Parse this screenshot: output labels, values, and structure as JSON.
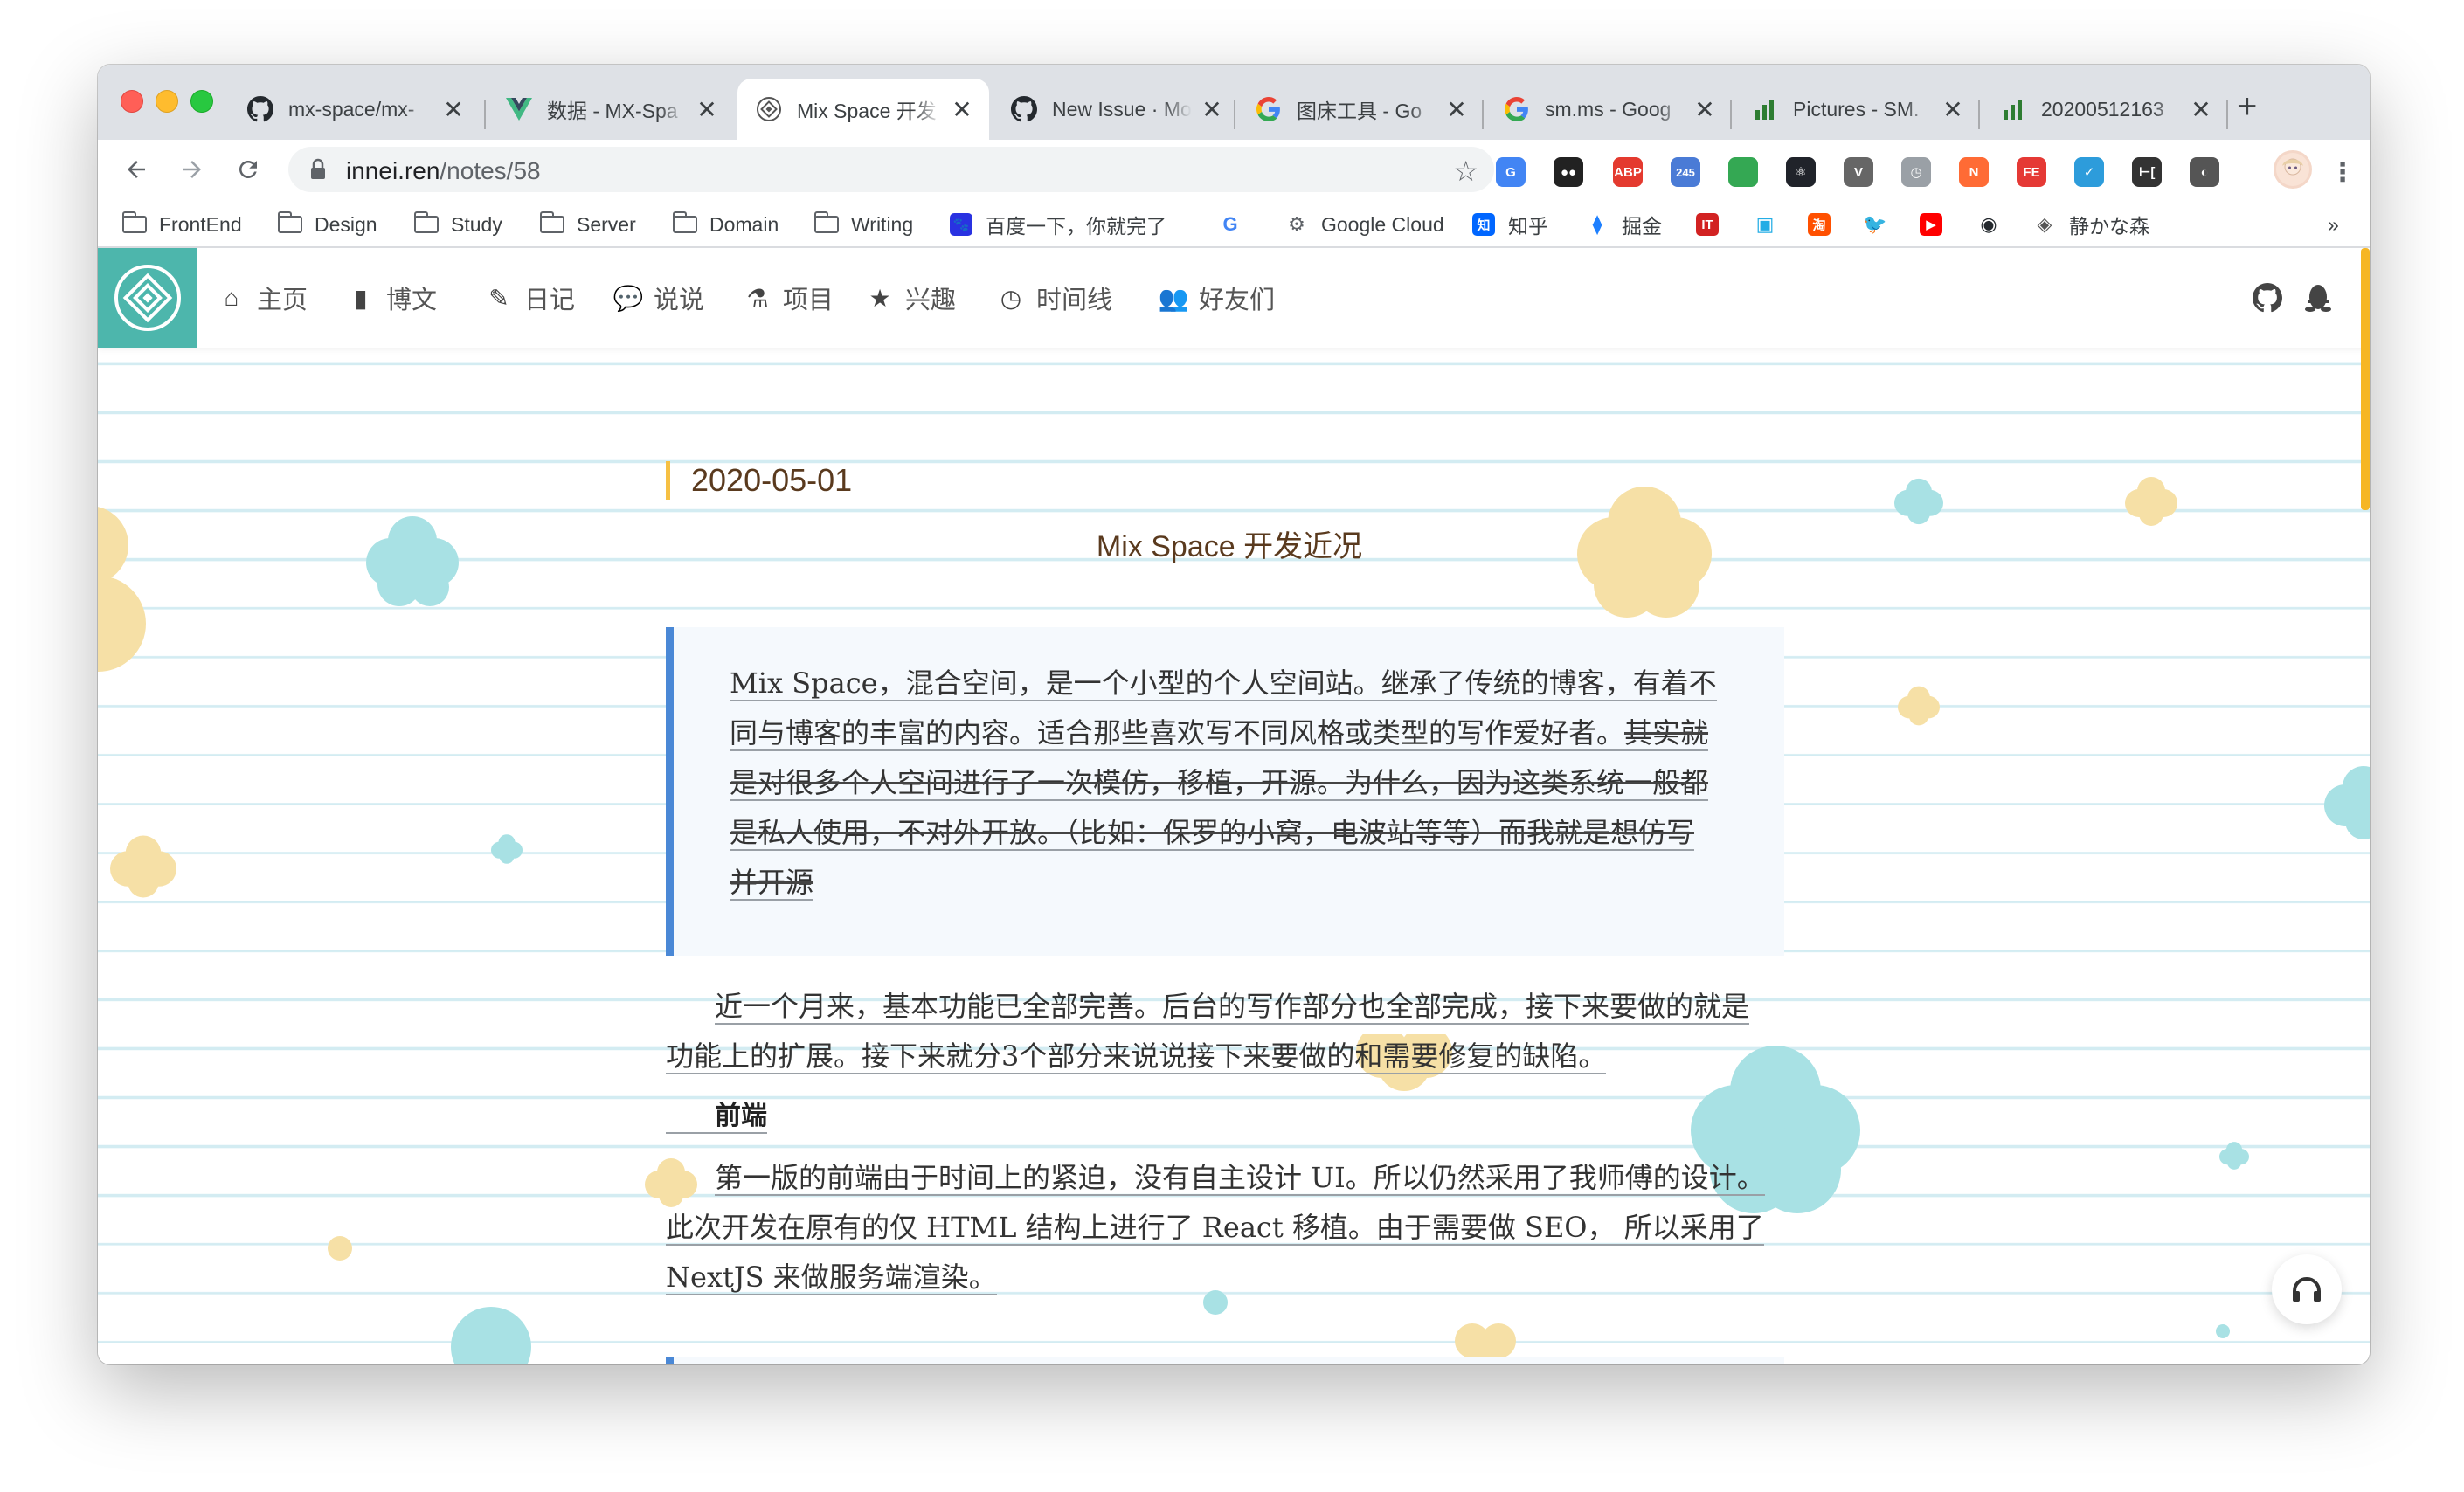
{
  "browser": {
    "tabs": [
      {
        "title": "mx-space/mx-",
        "icon": "github-icon"
      },
      {
        "title": "数据 - MX-Spa",
        "icon": "vue-icon"
      },
      {
        "title": "Mix Space 开发",
        "icon": "mix-space-icon",
        "active": true
      },
      {
        "title": "New Issue · Mo",
        "icon": "github-icon"
      },
      {
        "title": "图床工具 - Go",
        "icon": "google-icon"
      },
      {
        "title": "sm.ms - Goog",
        "icon": "google-icon"
      },
      {
        "title": "Pictures - SM.",
        "icon": "bar-chart-icon"
      },
      {
        "title": "20200512163",
        "icon": "bar-chart-icon"
      }
    ],
    "url": {
      "host": "innei.ren",
      "path": "/notes/58"
    },
    "extensions": [
      {
        "name": "translate-extension-icon",
        "label": "G",
        "color": "#4285f4"
      },
      {
        "name": "extension-icon",
        "label": "●●",
        "color": "#222222"
      },
      {
        "name": "adblock-plus-icon",
        "label": "ABP",
        "color": "#e43a2f"
      },
      {
        "name": "extension-badge-icon",
        "label": "245",
        "color": "#4a7bd6"
      },
      {
        "name": "green-circle-extension-icon",
        "label": "",
        "color": "#34a853"
      },
      {
        "name": "react-devtools-icon",
        "label": "⚛",
        "color": "#20232a"
      },
      {
        "name": "vue-devtools-icon",
        "label": "V",
        "color": "#666666"
      },
      {
        "name": "clock-extension-icon",
        "label": "◷",
        "color": "#9aa0a6"
      },
      {
        "name": "n-extension-icon",
        "label": "N",
        "color": "#ff6b35"
      },
      {
        "name": "fe-helper-icon",
        "label": "FE",
        "color": "#e53935"
      },
      {
        "name": "blue-extension-icon",
        "label": "✓",
        "color": "#2d9cdb"
      },
      {
        "name": "json-extension-icon",
        "label": "⊢[",
        "color": "#333333"
      },
      {
        "name": "dark-mode-icon",
        "label": "◐",
        "color": "#555555"
      }
    ],
    "bookmarks": [
      {
        "label": "FrontEnd",
        "icon": "folder-icon"
      },
      {
        "label": "Design",
        "icon": "folder-icon"
      },
      {
        "label": "Study",
        "icon": "folder-icon"
      },
      {
        "label": "Server",
        "icon": "folder-icon"
      },
      {
        "label": "Domain",
        "icon": "folder-icon"
      },
      {
        "label": "Writing",
        "icon": "folder-icon"
      },
      {
        "label": "百度一下，你就完了",
        "icon": "baidu-icon"
      },
      {
        "label": "",
        "icon": "google-icon"
      },
      {
        "label": "Google Cloud",
        "icon": "google-cloud-icon"
      },
      {
        "label": "知乎",
        "icon": "zhihu-icon"
      },
      {
        "label": "掘金",
        "icon": "juejin-icon"
      },
      {
        "label": "",
        "icon": "ithome-icon"
      },
      {
        "label": "",
        "icon": "bilibili-icon"
      },
      {
        "label": "",
        "icon": "taobao-icon"
      },
      {
        "label": "",
        "icon": "twitter-icon"
      },
      {
        "label": "",
        "icon": "youtube-icon"
      },
      {
        "label": "",
        "icon": "github-icon"
      },
      {
        "label": "静かな森",
        "icon": "mix-space-icon"
      }
    ],
    "bookmarks_overflow": "»"
  },
  "site": {
    "nav": [
      {
        "label": "主页",
        "icon": "home-icon"
      },
      {
        "label": "博文",
        "icon": "book-icon"
      },
      {
        "label": "日记",
        "icon": "pencil-icon"
      },
      {
        "label": "说说",
        "icon": "comments-icon"
      },
      {
        "label": "项目",
        "icon": "flask-icon"
      },
      {
        "label": "兴趣",
        "icon": "star-icon"
      },
      {
        "label": "时间线",
        "icon": "clock-icon"
      },
      {
        "label": "好友们",
        "icon": "users-icon"
      }
    ],
    "accent": "#4db6ac"
  },
  "note": {
    "date": "2020-05-01",
    "title": "Mix Space 开发近况",
    "quote": {
      "line1": "Mix Space，混合空间，是一个小型的个人空间站。继承了传统的博客，有着不",
      "line2_plain": "同与博客的丰富的内容。适合那些喜欢写不同风格或类型的写作爱好者。",
      "line2_strike": "其实就",
      "line3": "是对很多个人空间进行了一次模仿，移植，开源。为什么，因为这类系统一般都",
      "line4": "是私人使用，不对外开放。（比如：保罗的小窝，电波站等等）而我就是想仿写",
      "line5": "并开源"
    },
    "para1_line1": "近一个月来，基本功能已全部完善。后台的写作部分也全部完成，接下来要做的就是",
    "para1_line2": "功能上的扩展。接下来就分3个部分来说说接下来要做的和需要修复的缺陷。",
    "section_heading": "前端",
    "para2_line1": "第一版的前端由于时间上的紧迫，没有自主设计 UI。所以仍然采用了我师傅的设计。",
    "para2_line2": "此次开发在原有的仅 HTML 结构上进行了 React 移植。由于需要做 SEO， 所以采用了",
    "para2_line3": "NextJS 来做服务端渲染。"
  }
}
